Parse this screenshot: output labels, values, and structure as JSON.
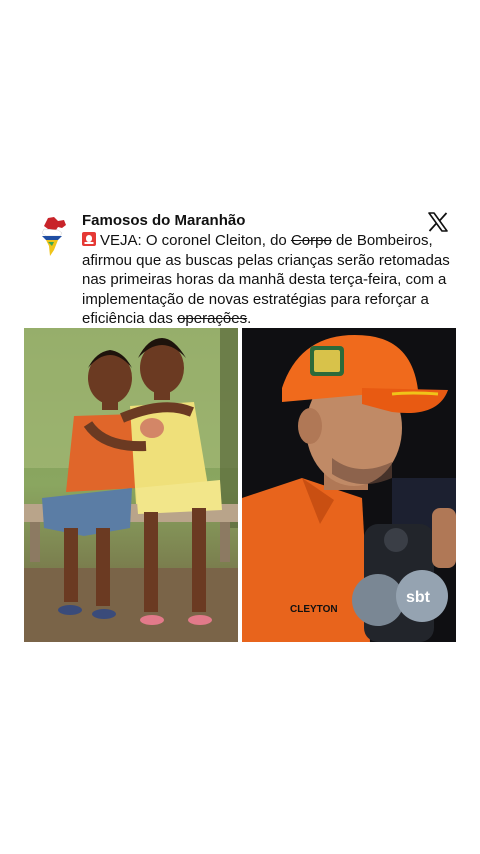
{
  "post": {
    "author": "Famosos do Maranhão",
    "text": {
      "p1": "VEJA: O coronel Cleiton, do ",
      "struck1": "Corpo",
      "p2": " de Bombeiros, afirmou que as buscas pelas crianças serão retomadas nas primeiras horas da manhã desta terça-feira, com a implementação de novas estratégias para reforçar a eficiência das ",
      "struck2": "operações",
      "p3": "."
    },
    "icons": {
      "siren": "police-siren-icon",
      "platform": "x-logo-icon",
      "avatar": "maranhao-map-icon"
    },
    "images": {
      "left": {
        "label": "two smiling children sitting on a bench"
      },
      "right": {
        "label": "firefighter colonel speaking to microphones",
        "uniform_name": "CLEYTON",
        "mic_brand": "sbt"
      }
    }
  }
}
